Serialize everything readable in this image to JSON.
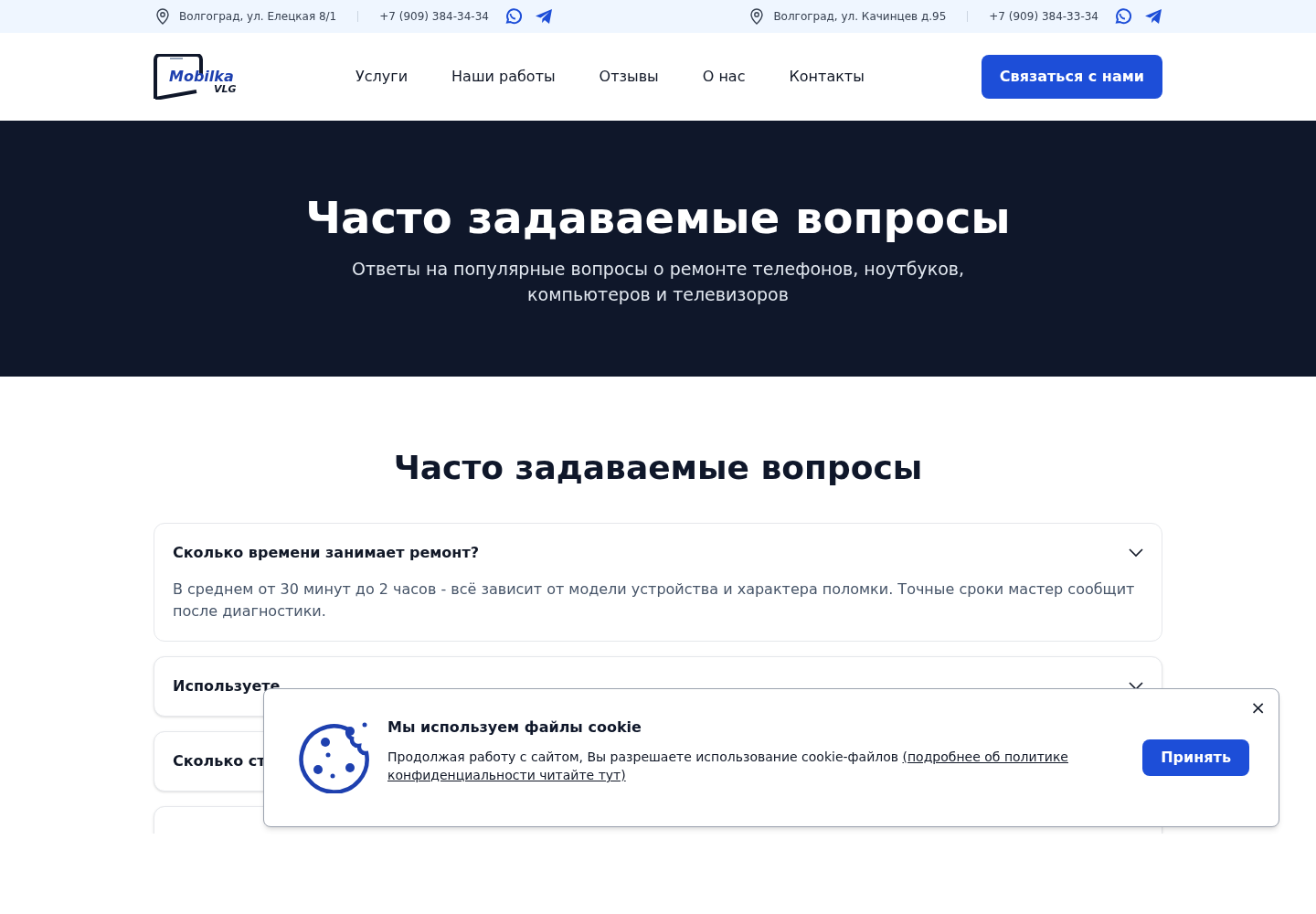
{
  "topbar": {
    "left": {
      "address": "Волгоград, ул. Елецкая 8/1",
      "phone": "+7 (909) 384-34-34"
    },
    "right": {
      "address": "Волгоград, ул. Качинцев д.95",
      "phone": "+7 (909) 384-33-34"
    }
  },
  "header": {
    "logo": {
      "word": "Mobilka",
      "sub": "VLG"
    },
    "nav": [
      "Услуги",
      "Наши работы",
      "Отзывы",
      "О нас",
      "Контакты"
    ],
    "cta": "Связаться с нами"
  },
  "hero": {
    "title": "Часто задаваемые вопросы",
    "subtitle": "Ответы на популярные вопросы о ремонте телефонов, ноутбуков, компьютеров и телевизоров"
  },
  "faq": {
    "title": "Часто задаваемые вопросы",
    "items": [
      {
        "question": "Сколько времени занимает ремонт?",
        "expanded": true,
        "answer": "В среднем от 30 минут до 2 часов - всё зависит от модели устройства и характера поломки. Точные сроки мастер сообщит после диагностики."
      },
      {
        "question": "Используете",
        "expanded": false
      },
      {
        "question": "Сколько ст",
        "expanded": false
      },
      {
        "expanded": false
      }
    ]
  },
  "cookie": {
    "title": "Мы используем файлы cookie",
    "text": "Продолжая работу с сайтом, Вы разрешаете использование cookie-файлов ",
    "link_lines": [
      "(подробнее об политике",
      "конфиденциальности читайте тут)"
    ],
    "accept": "Принять",
    "close": "×"
  }
}
